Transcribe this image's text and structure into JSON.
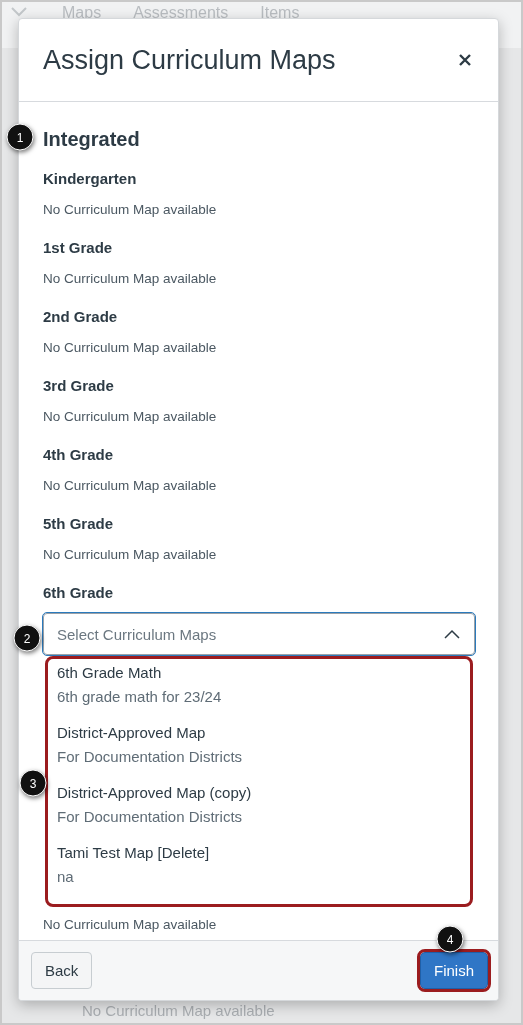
{
  "background": {
    "tabs": [
      "Maps",
      "Assessments",
      "Items"
    ],
    "footer_text": "No Curriculum Map available"
  },
  "dialog": {
    "title": "Assign Curriculum Maps",
    "section": "Integrated",
    "grades": [
      {
        "kind": "text",
        "name": "Kindergarten",
        "status": "No Curriculum Map available"
      },
      {
        "kind": "text",
        "name": "1st Grade",
        "status": "No Curriculum Map available"
      },
      {
        "kind": "text",
        "name": "2nd Grade",
        "status": "No Curriculum Map available"
      },
      {
        "kind": "text",
        "name": "3rd Grade",
        "status": "No Curriculum Map available"
      },
      {
        "kind": "text",
        "name": "4th Grade",
        "status": "No Curriculum Map available"
      },
      {
        "kind": "text",
        "name": "5th Grade",
        "status": "No Curriculum Map available"
      },
      {
        "kind": "select",
        "name": "6th Grade",
        "placeholder": "Select Curriculum Maps",
        "expanded": true,
        "highlighted": true,
        "options": [
          {
            "title": "6th Grade Math",
            "description": "6th grade math for 23/24"
          },
          {
            "title": "District-Approved Map",
            "description": "For Documentation Districts"
          },
          {
            "title": "District-Approved Map (copy)",
            "description": "For Documentation Districts"
          },
          {
            "title": "Tami Test Map [Delete]",
            "description": "na"
          }
        ]
      }
    ],
    "trailing_status": "No Curriculum Map available",
    "buttons": [
      {
        "kind": "secondary",
        "label": "Back",
        "highlighted": false
      },
      {
        "kind": "primary",
        "label": "Finish",
        "highlighted": true
      }
    ]
  },
  "callouts": [
    "1",
    "2",
    "3",
    "4"
  ]
}
